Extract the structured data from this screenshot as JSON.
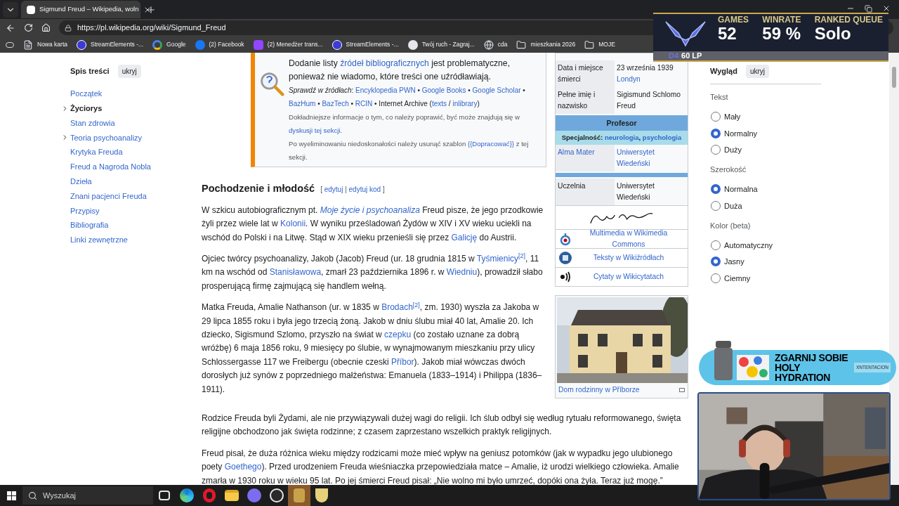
{
  "browser": {
    "tab": {
      "title": "Sigmund Freud – Wikipedia, woln",
      "selected": true
    },
    "url": "https://pl.wikipedia.org/wiki/Sigmund_Freud",
    "bookmarks": [
      {
        "label": "Nowa karta",
        "kind": "page"
      },
      {
        "label": "StreamElements -...",
        "kind": "streamelements"
      },
      {
        "label": "Google",
        "kind": "google"
      },
      {
        "label": "(2) Facebook",
        "kind": "facebook"
      },
      {
        "label": "(2) Menedżer trans...",
        "kind": "twitch"
      },
      {
        "label": "StreamElements -...",
        "kind": "streamelements"
      },
      {
        "label": "Twój ruch - Zagraj...",
        "kind": "chess"
      },
      {
        "label": "cda",
        "kind": "globe"
      },
      {
        "label": "mieszkania 2026",
        "kind": "folder"
      },
      {
        "label": "MOJE",
        "kind": "folder"
      }
    ]
  },
  "toc": {
    "title": "Spis treści",
    "hide_button": "ukryj",
    "items": [
      {
        "label": "Początek",
        "selected": false,
        "has_subsections": false
      },
      {
        "label": "Życiorys",
        "selected": true,
        "has_subsections": true
      },
      {
        "label": "Stan zdrowia",
        "selected": false,
        "has_subsections": false
      },
      {
        "label": "Teoria psychoanalizy",
        "selected": false,
        "has_subsections": true
      },
      {
        "label": "Krytyka Freuda",
        "selected": false,
        "has_subsections": false
      },
      {
        "label": "Freud a Nagroda Nobla",
        "selected": false,
        "has_subsections": false
      },
      {
        "label": "Dzieła",
        "selected": false,
        "has_subsections": false
      },
      {
        "label": "Znani pacjenci Freuda",
        "selected": false,
        "has_subsections": false
      },
      {
        "label": "Przypisy",
        "selected": false,
        "has_subsections": false
      },
      {
        "label": "Bibliografia",
        "selected": false,
        "has_subsections": false
      },
      {
        "label": "Linki zewnętrzne",
        "selected": false,
        "has_subsections": false
      }
    ]
  },
  "notice": {
    "lines": [
      {
        "kind": "message",
        "segs": [
          {
            "kind": "text",
            "t": "Dodanie listy "
          },
          {
            "kind": "link",
            "t": "źródeł bibliograficznych"
          },
          {
            "kind": "text",
            "t": " jest problematyczne, ponieważ nie wiadomo, które treści one uźródławiają."
          }
        ]
      },
      {
        "kind": "sources",
        "segs": [
          {
            "kind": "italic",
            "t": "Sprawdź w źródłach"
          },
          {
            "kind": "text",
            "t": ": "
          },
          {
            "kind": "link",
            "t": "Encyklopedia PWN"
          },
          {
            "kind": "text",
            "t": " • "
          },
          {
            "kind": "link",
            "t": "Google Books"
          },
          {
            "kind": "text",
            "t": " • "
          },
          {
            "kind": "link",
            "t": "Google Scholar"
          },
          {
            "kind": "text",
            "t": " • "
          },
          {
            "kind": "link",
            "t": "BazHum"
          },
          {
            "kind": "text",
            "t": " • "
          },
          {
            "kind": "link",
            "t": "BazTech"
          },
          {
            "kind": "text",
            "t": " • "
          },
          {
            "kind": "link",
            "t": "RCIN"
          },
          {
            "kind": "text",
            "t": " • Internet Archive ("
          },
          {
            "kind": "link",
            "t": "texts"
          },
          {
            "kind": "text",
            "t": " / "
          },
          {
            "kind": "link",
            "t": "inlibrary"
          },
          {
            "kind": "text",
            "t": ")"
          }
        ]
      },
      {
        "kind": "note",
        "segs": [
          {
            "kind": "text",
            "t": "Dokładniejsze informacje o tym, co należy poprawić, być może znajdują się w "
          },
          {
            "kind": "link",
            "t": "dyskusji"
          },
          {
            "kind": "link",
            "t": "tej sekcji"
          },
          {
            "kind": "text",
            "t": "."
          }
        ]
      },
      {
        "kind": "note",
        "segs": [
          {
            "kind": "text",
            "t": "Po wyeliminowaniu niedoskonałości należy usunąć szablon "
          },
          {
            "kind": "link",
            "t": "{{Dopracować}}"
          },
          {
            "kind": "text",
            "t": " z tej sekcji."
          }
        ]
      }
    ]
  },
  "section": {
    "heading": "Pochodzenie i młodość",
    "edit_links": [
      {
        "kind": "text",
        "t": "[ "
      },
      {
        "kind": "link",
        "t": "edytuj"
      },
      {
        "kind": "text",
        "t": " | "
      },
      {
        "kind": "link",
        "t": "edytuj kod"
      },
      {
        "kind": "text",
        "t": " ]"
      }
    ],
    "paragraphs_beside": [
      [
        {
          "kind": "text",
          "t": "W szkicu autobiograficznym pt. "
        },
        {
          "kind": "italic_link",
          "t": "Moje życie i psychoanaliza"
        },
        {
          "kind": "text",
          "t": " Freud pisze, że jego przodkowie żyli przez wiele lat w "
        },
        {
          "kind": "link",
          "t": "Kolonii"
        },
        {
          "kind": "text",
          "t": ". W wyniku prześladowań Żydów w XIV i XV wieku uciekli na wschód do Polski i na Litwę. Stąd w XIX wieku przenieśli się przez "
        },
        {
          "kind": "link",
          "t": "Galicję"
        },
        {
          "kind": "text",
          "t": " do Austrii."
        }
      ],
      [
        {
          "kind": "text",
          "t": "Ojciec twórcy psychoanalizy, Jakob (Jacob) Freud (ur. 18 grudnia 1815 w "
        },
        {
          "kind": "link",
          "t": "Tyśmienicy"
        },
        {
          "kind": "ref",
          "t": "[2]"
        },
        {
          "kind": "text",
          "t": ", 11 km na wschód od "
        },
        {
          "kind": "link",
          "t": "Stanisławowa"
        },
        {
          "kind": "text",
          "t": ", zmarł 23 października 1896 r. w "
        },
        {
          "kind": "link",
          "t": "Wiedniu"
        },
        {
          "kind": "text",
          "t": "), prowadził słabo prosperującą firmę zajmującą się handlem wełną."
        }
      ],
      [
        {
          "kind": "text",
          "t": "Matka Freuda, Amalie Nathanson (ur. w 1835 w "
        },
        {
          "kind": "link",
          "t": "Brodach"
        },
        {
          "kind": "ref",
          "t": "[2]"
        },
        {
          "kind": "text",
          "t": ", zm. 1930) wyszła za Jakoba w 29 lipca 1855 roku i była jego trzecią żoną. Jakob w dniu ślubu miał 40 lat, Amalie 20. Ich dziecko, Sigismund Szlomo, przyszło na świat w "
        },
        {
          "kind": "link",
          "t": "czepku"
        },
        {
          "kind": "text",
          "t": " (co zostało uznane za dobrą wróżbę) 6 maja 1856 roku, 9 miesięcy po ślubie, w wynajmowanym mieszkaniu przy ulicy Schlossergasse 117 we Freibergu (obecnie czeski "
        },
        {
          "kind": "link",
          "t": "Příbor"
        },
        {
          "kind": "text",
          "t": "). Jakob miał wówczas dwóch dorosłych już synów z poprzedniego małżeństwa: Emanuela (1833–1914) i Philippa (1836–1911)."
        }
      ]
    ],
    "paragraphs_full": [
      [
        {
          "kind": "text",
          "t": "Rodzice Freuda byli Żydami, ale nie przywiązywali dużej wagi do religii. Ich ślub odbył się według rytuału reformowanego, święta religijne obchodzono jak święta rodzinne; z czasem zaprzestano wszelkich praktyk religijnych."
        }
      ],
      [
        {
          "kind": "text",
          "t": "Freud pisał, że duża różnica wieku między rodzicami może mieć wpływ na geniusz potomków (jak w wypadku jego ulubionego poety "
        },
        {
          "kind": "link",
          "t": "Goethego"
        },
        {
          "kind": "text",
          "t": "). Przed urodzeniem Freuda wieśniaczka przepowiedziała matce – Amalie, iż urodzi wielkiego człowieka. Amalie zmarła w 1930 roku w wieku 95 lat. Po jej śmierci Freud pisał: „Nie wolno mi było umrzeć, dopóki ona żyła. Teraz już mogę.”"
        }
      ]
    ]
  },
  "infobox": {
    "rows": [
      {
        "kind": "row",
        "label": [
          {
            "kind": "text",
            "t": "Data i miejsce śmierci"
          }
        ],
        "value": [
          {
            "kind": "text",
            "t": "23 września 1939 "
          },
          {
            "kind": "link",
            "t": "Londyn"
          }
        ]
      },
      {
        "kind": "row",
        "label": [
          {
            "kind": "text",
            "t": "Pełne imię i nazwisko"
          }
        ],
        "value": [
          {
            "kind": "text",
            "t": "Sigismund Schlomo Freud"
          }
        ]
      },
      {
        "kind": "header",
        "segs": [
          {
            "kind": "text",
            "t": "Profesor"
          }
        ]
      },
      {
        "kind": "subheader",
        "segs": [
          {
            "kind": "text",
            "t": "Specjalność: "
          },
          {
            "kind": "link",
            "t": "neurologia"
          },
          {
            "kind": "text",
            "t": ", "
          },
          {
            "kind": "link",
            "t": "psychologia"
          }
        ]
      },
      {
        "kind": "row",
        "label": [
          {
            "kind": "block_link",
            "t": "Alma Mater"
          }
        ],
        "value": [
          {
            "kind": "block_link",
            "t": "Uniwersytet Wiedeński"
          }
        ]
      },
      {
        "kind": "divider"
      },
      {
        "kind": "row",
        "label": [
          {
            "kind": "text",
            "t": "Uczelnia"
          }
        ],
        "value": [
          {
            "kind": "text",
            "t": "Uniwersytet Wiedeński"
          }
        ]
      },
      {
        "kind": "signature"
      }
    ],
    "sister_links": [
      {
        "kind": "commons",
        "label": "Multimedia w Wikimedia Commons"
      },
      {
        "kind": "wikisource",
        "label": "Teksty w Wikiźródłach"
      },
      {
        "kind": "wikiquote",
        "label": "Cytaty w Wikicytatach"
      }
    ],
    "figure": {
      "kind": "picture",
      "caption": "Dom rodzinny w Příborze"
    }
  },
  "appearance": {
    "title": "Wygląd",
    "hide_button": "ukryj",
    "groups": [
      {
        "title": "Tekst",
        "options": [
          {
            "label": "Mały",
            "selected": false
          },
          {
            "label": "Normalny",
            "selected": true
          },
          {
            "label": "Duży",
            "selected": false
          }
        ]
      },
      {
        "title": "Szerokość",
        "options": [
          {
            "label": "Normalna",
            "selected": true
          },
          {
            "label": "Duża",
            "selected": false
          }
        ]
      },
      {
        "title": "Kolor (beta)",
        "options": [
          {
            "label": "Automatyczny",
            "selected": false
          },
          {
            "label": "Jasny",
            "selected": true
          },
          {
            "label": "Ciemny",
            "selected": false
          }
        ]
      }
    ]
  },
  "rank_overlay": {
    "division": "D4",
    "lp": "60 LP",
    "stats": [
      {
        "label": "GAMES",
        "value": "52"
      },
      {
        "label": "WINRATE",
        "value": "59 %"
      },
      {
        "label": "RANKED QUEUE",
        "value": "Solo"
      }
    ]
  },
  "ad": {
    "headline_1": "ZGARNIJ SOBIE",
    "headline_2": "HOLY HYDRATION",
    "code": "XNTENTACION"
  },
  "taskbar": {
    "search_placeholder": "Wyszukaj",
    "apps": [
      {
        "kind": "taskview",
        "active": false
      },
      {
        "kind": "edge",
        "active": false
      },
      {
        "kind": "opera",
        "active": false
      },
      {
        "kind": "folder",
        "active": false
      },
      {
        "kind": "chat",
        "active": false
      },
      {
        "kind": "obs",
        "active": false
      },
      {
        "kind": "league",
        "active": true
      },
      {
        "kind": "shield",
        "active": false
      }
    ]
  }
}
